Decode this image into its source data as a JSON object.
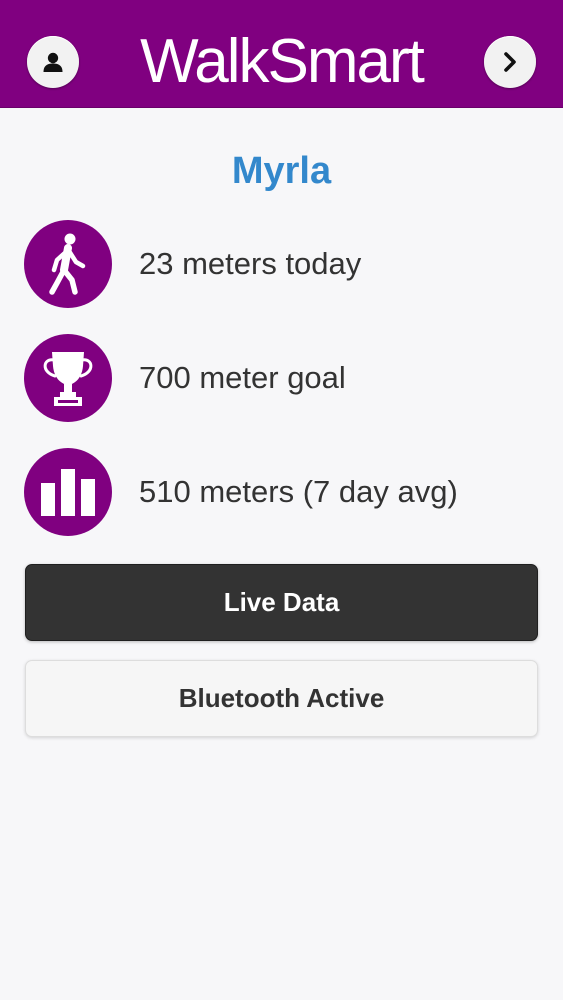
{
  "header": {
    "title": "WalkSmart",
    "left_icon": "user-icon",
    "right_icon": "chevron-right-icon",
    "background_color": "#800080"
  },
  "profile": {
    "name": "Myrla",
    "name_color": "#3388cc"
  },
  "stats": [
    {
      "icon": "walking-person-icon",
      "text": "23 meters today"
    },
    {
      "icon": "trophy-icon",
      "text": "700 meter goal"
    },
    {
      "icon": "bar-chart-icon",
      "text": "510 meters (7 day avg)"
    }
  ],
  "buttons": {
    "live_data": "Live Data",
    "bluetooth": "Bluetooth Active"
  }
}
